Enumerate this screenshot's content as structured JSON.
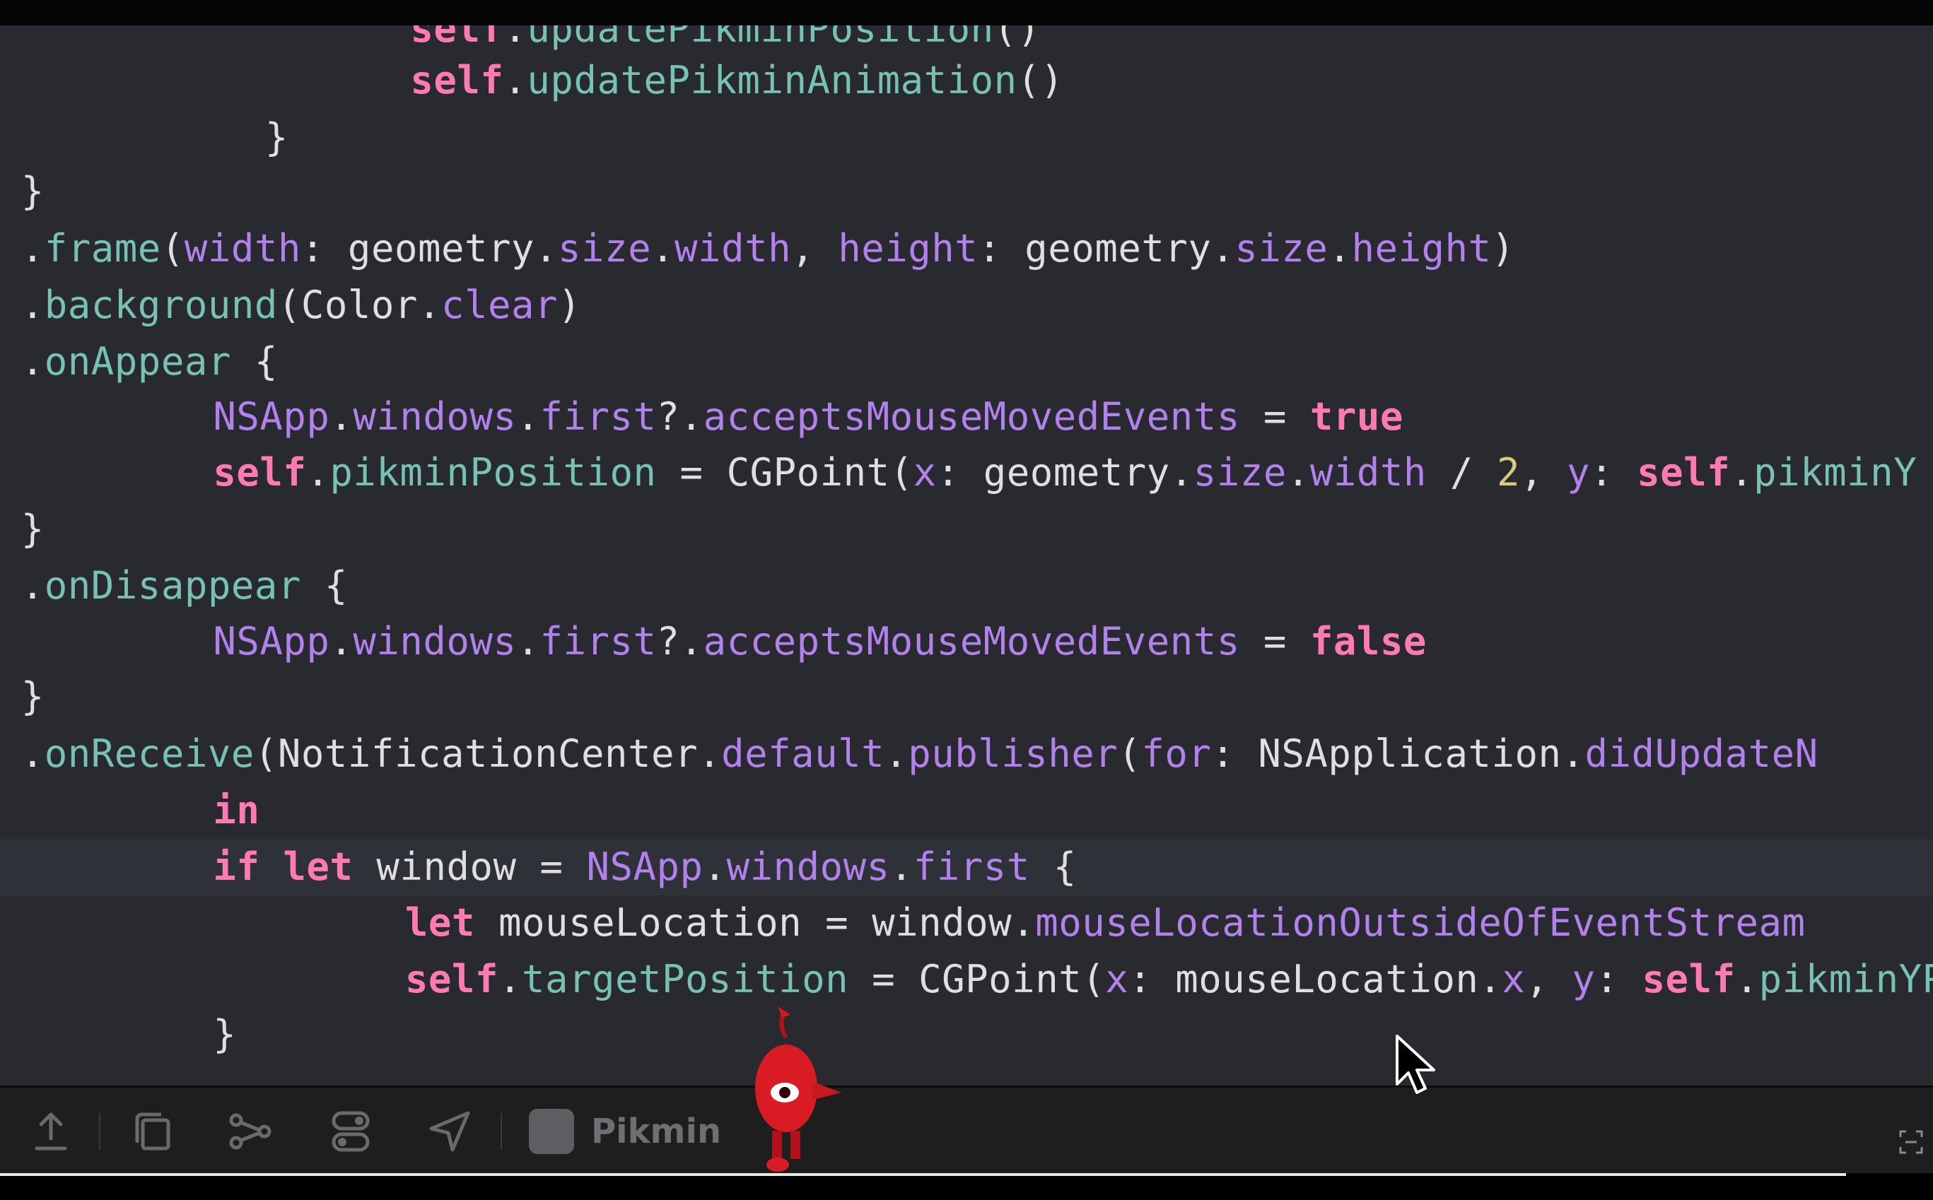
{
  "editor": {
    "lines": [
      [
        {
          "t": "    ",
          "c": "plain"
        },
        {
          "t": "self",
          "c": "kw"
        },
        {
          "t": ".",
          "c": "plain"
        },
        {
          "t": "updatePikminPosition",
          "c": "fn"
        },
        {
          "t": "()",
          "c": "plain"
        }
      ],
      [
        {
          "t": "    ",
          "c": "plain"
        },
        {
          "t": "self",
          "c": "kw"
        },
        {
          "t": ".",
          "c": "plain"
        },
        {
          "t": "updatePikminAnimation",
          "c": "fn"
        },
        {
          "t": "()",
          "c": "plain"
        }
      ],
      [
        {
          "t": "  }",
          "c": "plain"
        }
      ],
      [
        {
          "t": "}",
          "c": "plain"
        }
      ],
      [
        {
          "t": ".",
          "c": "plain"
        },
        {
          "t": "frame",
          "c": "fn"
        },
        {
          "t": "(",
          "c": "plain"
        },
        {
          "t": "width",
          "c": "prop"
        },
        {
          "t": ": geometry.",
          "c": "plain"
        },
        {
          "t": "size",
          "c": "prop"
        },
        {
          "t": ".",
          "c": "plain"
        },
        {
          "t": "width",
          "c": "prop"
        },
        {
          "t": ", ",
          "c": "plain"
        },
        {
          "t": "height",
          "c": "prop"
        },
        {
          "t": ": geometry.",
          "c": "plain"
        },
        {
          "t": "size",
          "c": "prop"
        },
        {
          "t": ".",
          "c": "plain"
        },
        {
          "t": "height",
          "c": "prop"
        },
        {
          "t": ")",
          "c": "plain"
        }
      ],
      [
        {
          "t": ".",
          "c": "plain"
        },
        {
          "t": "background",
          "c": "fn"
        },
        {
          "t": "(Color.",
          "c": "plain"
        },
        {
          "t": "clear",
          "c": "prop"
        },
        {
          "t": ")",
          "c": "plain"
        }
      ],
      [
        {
          "t": ".",
          "c": "plain"
        },
        {
          "t": "onAppear",
          "c": "fn"
        },
        {
          "t": " {",
          "c": "plain"
        }
      ],
      [
        {
          "t": "    ",
          "c": "plain"
        },
        {
          "t": "NSApp",
          "c": "prop"
        },
        {
          "t": ".",
          "c": "plain"
        },
        {
          "t": "windows",
          "c": "prop"
        },
        {
          "t": ".",
          "c": "plain"
        },
        {
          "t": "first",
          "c": "prop"
        },
        {
          "t": "?.",
          "c": "plain"
        },
        {
          "t": "acceptsMouseMovedEvents",
          "c": "prop"
        },
        {
          "t": " = ",
          "c": "plain"
        },
        {
          "t": "true",
          "c": "kw"
        }
      ],
      [
        {
          "t": "    ",
          "c": "plain"
        },
        {
          "t": "self",
          "c": "kw"
        },
        {
          "t": ".",
          "c": "plain"
        },
        {
          "t": "pikminPosition",
          "c": "fn"
        },
        {
          "t": " = CGPoint(",
          "c": "plain"
        },
        {
          "t": "x",
          "c": "prop"
        },
        {
          "t": ": geometry.",
          "c": "plain"
        },
        {
          "t": "size",
          "c": "prop"
        },
        {
          "t": ".",
          "c": "plain"
        },
        {
          "t": "width",
          "c": "prop"
        },
        {
          "t": " / ",
          "c": "plain"
        },
        {
          "t": "2",
          "c": "num"
        },
        {
          "t": ", ",
          "c": "plain"
        },
        {
          "t": "y",
          "c": "prop"
        },
        {
          "t": ": ",
          "c": "plain"
        },
        {
          "t": "self",
          "c": "kw"
        },
        {
          "t": ".",
          "c": "plain"
        },
        {
          "t": "pikminY",
          "c": "fn"
        }
      ],
      [
        {
          "t": "}",
          "c": "plain"
        }
      ],
      [
        {
          "t": ".",
          "c": "plain"
        },
        {
          "t": "onDisappear",
          "c": "fn"
        },
        {
          "t": " {",
          "c": "plain"
        }
      ],
      [
        {
          "t": "    ",
          "c": "plain"
        },
        {
          "t": "NSApp",
          "c": "prop"
        },
        {
          "t": ".",
          "c": "plain"
        },
        {
          "t": "windows",
          "c": "prop"
        },
        {
          "t": ".",
          "c": "plain"
        },
        {
          "t": "first",
          "c": "prop"
        },
        {
          "t": "?.",
          "c": "plain"
        },
        {
          "t": "acceptsMouseMovedEvents",
          "c": "prop"
        },
        {
          "t": " = ",
          "c": "plain"
        },
        {
          "t": "false",
          "c": "kw"
        }
      ],
      [
        {
          "t": "}",
          "c": "plain"
        }
      ],
      [
        {
          "t": ".",
          "c": "plain"
        },
        {
          "t": "onReceive",
          "c": "fn"
        },
        {
          "t": "(NotificationCenter.",
          "c": "plain"
        },
        {
          "t": "default",
          "c": "prop"
        },
        {
          "t": ".",
          "c": "plain"
        },
        {
          "t": "publisher",
          "c": "prop"
        },
        {
          "t": "(",
          "c": "plain"
        },
        {
          "t": "for",
          "c": "prop"
        },
        {
          "t": ": NSApplication.",
          "c": "plain"
        },
        {
          "t": "didUpdateN",
          "c": "prop"
        }
      ],
      [
        {
          "t": "    ",
          "c": "plain"
        },
        {
          "t": "in",
          "c": "kw"
        }
      ],
      [
        {
          "t": "    ",
          "c": "plain"
        },
        {
          "t": "if",
          "c": "kw"
        },
        {
          "t": " ",
          "c": "plain"
        },
        {
          "t": "let",
          "c": "kw"
        },
        {
          "t": " window = ",
          "c": "plain"
        },
        {
          "t": "NSApp",
          "c": "prop"
        },
        {
          "t": ".",
          "c": "plain"
        },
        {
          "t": "windows",
          "c": "prop"
        },
        {
          "t": ".",
          "c": "plain"
        },
        {
          "t": "first",
          "c": "prop"
        },
        {
          "t": " {",
          "c": "plain"
        }
      ],
      [
        {
          "t": "        ",
          "c": "plain"
        },
        {
          "t": "let",
          "c": "kw"
        },
        {
          "t": " mouseLocation = window.",
          "c": "plain"
        },
        {
          "t": "mouseLocationOutsideOfEventStream",
          "c": "prop"
        }
      ],
      [
        {
          "t": "        ",
          "c": "plain"
        },
        {
          "t": "self",
          "c": "kw"
        },
        {
          "t": ".",
          "c": "plain"
        },
        {
          "t": "targetPosition",
          "c": "fn"
        },
        {
          "t": " = CGPoint(",
          "c": "plain"
        },
        {
          "t": "x",
          "c": "prop"
        },
        {
          "t": ": mouseLocation.",
          "c": "plain"
        },
        {
          "t": "x",
          "c": "prop"
        },
        {
          "t": ", ",
          "c": "plain"
        },
        {
          "t": "y",
          "c": "prop"
        },
        {
          "t": ": ",
          "c": "plain"
        },
        {
          "t": "self",
          "c": "kw"
        },
        {
          "t": ".",
          "c": "plain"
        },
        {
          "t": "pikminYPosi",
          "c": "fn"
        }
      ],
      [
        {
          "t": "    }",
          "c": "plain"
        }
      ]
    ]
  },
  "toolbar": {
    "icons": [
      "upload-icon",
      "layers-icon",
      "branch-icon",
      "toggles-icon",
      "location-arrow-icon"
    ],
    "scheme_label": "Pikmin"
  },
  "colors": {
    "background": "#292a30",
    "keyword": "#ff7ab2",
    "property": "#b281eb",
    "function": "#78c2b3",
    "number": "#d9c97c",
    "text": "#dfdfe0"
  },
  "playback": {
    "progress": 0.955
  }
}
